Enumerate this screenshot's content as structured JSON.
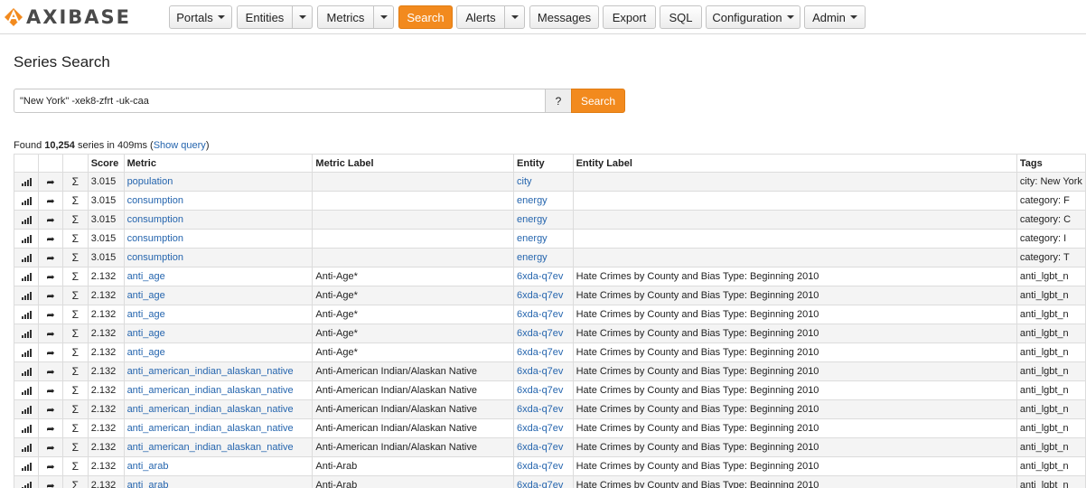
{
  "brand": {
    "name": "AXIBASE"
  },
  "nav": {
    "portals": "Portals",
    "entities": "Entities",
    "metrics": "Metrics",
    "search": "Search",
    "alerts": "Alerts",
    "messages": "Messages",
    "export": "Export",
    "sql": "SQL",
    "configuration": "Configuration",
    "admin": "Admin"
  },
  "page": {
    "title": "Series Search"
  },
  "search": {
    "query": "\"New York\" -xek8-zfrt -uk-caa",
    "help_label": "?",
    "button_label": "Search"
  },
  "summary": {
    "prefix": "Found ",
    "count": "10,254",
    "middle": " series in 409ms (",
    "show_query": "Show query",
    "suffix": ")"
  },
  "table": {
    "columns": [
      "Score",
      "Metric",
      "Metric Label",
      "Entity",
      "Entity Label",
      "Tags"
    ],
    "rows": [
      {
        "score": "3.015",
        "metric": "population",
        "metric_label": "",
        "entity": "city",
        "entity_label": "",
        "tags": "city: New York"
      },
      {
        "score": "3.015",
        "metric": "consumption",
        "metric_label": "",
        "entity": "energy",
        "entity_label": "",
        "tags": "category: F"
      },
      {
        "score": "3.015",
        "metric": "consumption",
        "metric_label": "",
        "entity": "energy",
        "entity_label": "",
        "tags": "category: C"
      },
      {
        "score": "3.015",
        "metric": "consumption",
        "metric_label": "",
        "entity": "energy",
        "entity_label": "",
        "tags": "category: I"
      },
      {
        "score": "3.015",
        "metric": "consumption",
        "metric_label": "",
        "entity": "energy",
        "entity_label": "",
        "tags": "category: T"
      },
      {
        "score": "2.132",
        "metric": "anti_age",
        "metric_label": "Anti-Age*",
        "entity": "6xda-q7ev",
        "entity_label": "Hate Crimes by County and Bias Type: Beginning 2010",
        "tags": "anti_lgbt_n"
      },
      {
        "score": "2.132",
        "metric": "anti_age",
        "metric_label": "Anti-Age*",
        "entity": "6xda-q7ev",
        "entity_label": "Hate Crimes by County and Bias Type: Beginning 2010",
        "tags": "anti_lgbt_n"
      },
      {
        "score": "2.132",
        "metric": "anti_age",
        "metric_label": "Anti-Age*",
        "entity": "6xda-q7ev",
        "entity_label": "Hate Crimes by County and Bias Type: Beginning 2010",
        "tags": "anti_lgbt_n"
      },
      {
        "score": "2.132",
        "metric": "anti_age",
        "metric_label": "Anti-Age*",
        "entity": "6xda-q7ev",
        "entity_label": "Hate Crimes by County and Bias Type: Beginning 2010",
        "tags": "anti_lgbt_n"
      },
      {
        "score": "2.132",
        "metric": "anti_age",
        "metric_label": "Anti-Age*",
        "entity": "6xda-q7ev",
        "entity_label": "Hate Crimes by County and Bias Type: Beginning 2010",
        "tags": "anti_lgbt_n"
      },
      {
        "score": "2.132",
        "metric": "anti_american_indian_alaskan_native",
        "metric_label": "Anti-American Indian/Alaskan Native",
        "entity": "6xda-q7ev",
        "entity_label": "Hate Crimes by County and Bias Type: Beginning 2010",
        "tags": "anti_lgbt_n"
      },
      {
        "score": "2.132",
        "metric": "anti_american_indian_alaskan_native",
        "metric_label": "Anti-American Indian/Alaskan Native",
        "entity": "6xda-q7ev",
        "entity_label": "Hate Crimes by County and Bias Type: Beginning 2010",
        "tags": "anti_lgbt_n"
      },
      {
        "score": "2.132",
        "metric": "anti_american_indian_alaskan_native",
        "metric_label": "Anti-American Indian/Alaskan Native",
        "entity": "6xda-q7ev",
        "entity_label": "Hate Crimes by County and Bias Type: Beginning 2010",
        "tags": "anti_lgbt_n"
      },
      {
        "score": "2.132",
        "metric": "anti_american_indian_alaskan_native",
        "metric_label": "Anti-American Indian/Alaskan Native",
        "entity": "6xda-q7ev",
        "entity_label": "Hate Crimes by County and Bias Type: Beginning 2010",
        "tags": "anti_lgbt_n"
      },
      {
        "score": "2.132",
        "metric": "anti_american_indian_alaskan_native",
        "metric_label": "Anti-American Indian/Alaskan Native",
        "entity": "6xda-q7ev",
        "entity_label": "Hate Crimes by County and Bias Type: Beginning 2010",
        "tags": "anti_lgbt_n"
      },
      {
        "score": "2.132",
        "metric": "anti_arab",
        "metric_label": "Anti-Arab",
        "entity": "6xda-q7ev",
        "entity_label": "Hate Crimes by County and Bias Type: Beginning 2010",
        "tags": "anti_lgbt_n"
      },
      {
        "score": "2.132",
        "metric": "anti_arab",
        "metric_label": "Anti-Arab",
        "entity": "6xda-q7ev",
        "entity_label": "Hate Crimes by County and Bias Type: Beginning 2010",
        "tags": "anti_lgbt_n"
      }
    ]
  },
  "icons": {
    "chart": "bar-chart-icon",
    "open": "share-arrow-icon",
    "sum": "sigma-icon"
  },
  "colors": {
    "accent": "#f28a1e",
    "link": "#2565ae",
    "row_alt": "#f4f4f4"
  }
}
